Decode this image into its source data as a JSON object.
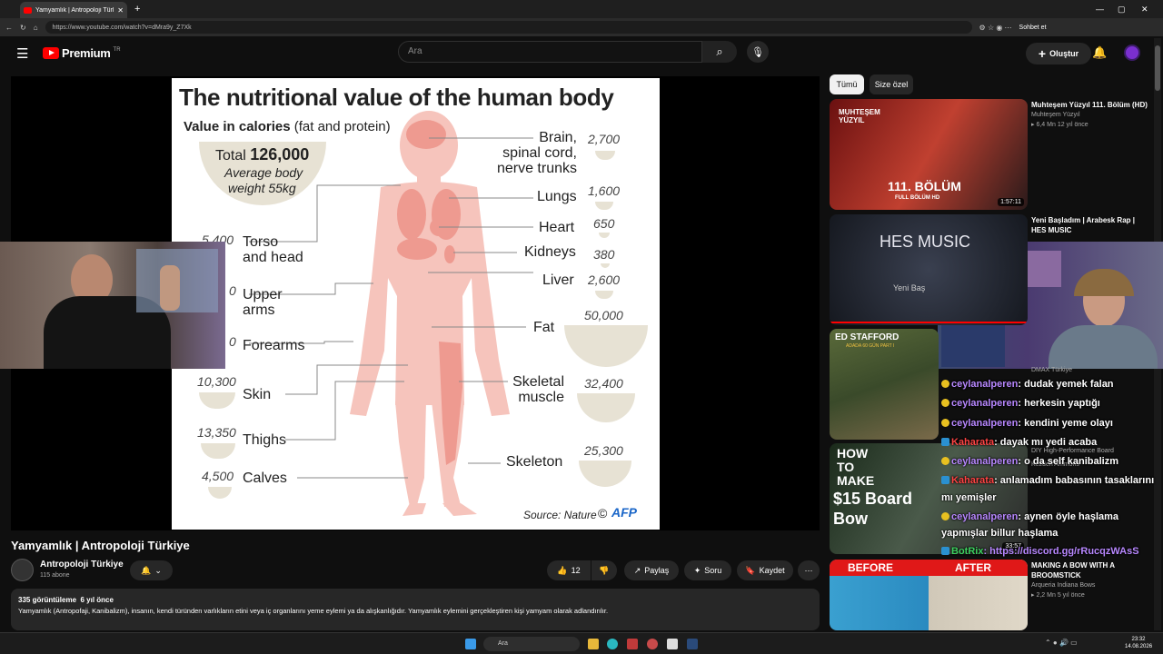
{
  "browser": {
    "tab_title": "Yamyamlık | Antropoloji Türkiye -",
    "url": "https://www.youtube.com/watch?v=dMra9y_Z7Xk",
    "chat_button": "Sohbet et"
  },
  "header": {
    "logo_text": "Premium",
    "logo_region": "TR",
    "search_placeholder": "Ara",
    "create_label": "Oluştur"
  },
  "chips": [
    "Tümü",
    "Size özel"
  ],
  "chart": {
    "title": "The nutritional value of the human body",
    "subtitle_bold": "Value in calories",
    "subtitle_rest": "(fat and protein)",
    "total_prefix": "Total",
    "total_value": "126,000",
    "avg1": "Average body",
    "avg2": "weight 55kg",
    "source": "Source: Nature",
    "agency": "AFP",
    "left": [
      {
        "label": "Torso",
        "label2": "and head",
        "value": "5,400"
      },
      {
        "label": "Upper",
        "label2": "arms",
        "value": "0"
      },
      {
        "label": "Forearms",
        "label2": "",
        "value": "0"
      },
      {
        "label": "Skin",
        "label2": "",
        "value": "10,300"
      },
      {
        "label": "Thighs",
        "label2": "",
        "value": "13,350"
      },
      {
        "label": "Calves",
        "label2": "",
        "value": "4,500"
      }
    ],
    "right": [
      {
        "label": "Brain,",
        "label2": "spinal cord,",
        "label3": "nerve trunks",
        "value": "2,700"
      },
      {
        "label": "Lungs",
        "value": "1,600"
      },
      {
        "label": "Heart",
        "value": "650"
      },
      {
        "label": "Kidneys",
        "value": "380"
      },
      {
        "label": "Liver",
        "value": "2,600"
      },
      {
        "label": "Fat",
        "value": "50,000"
      },
      {
        "label": "Skeletal",
        "label2": "muscle",
        "value": "32,400"
      },
      {
        "label": "Skeleton",
        "value": "25,300"
      }
    ]
  },
  "video": {
    "title": "Yamyamlık | Antropoloji Türkiye",
    "channel": "Antropoloji Türkiye",
    "subscribers": "115 abone",
    "likes": "12",
    "share": "Paylaş",
    "ask": "Soru",
    "save": "Kaydet",
    "views": "335 görüntüleme",
    "age": "6 yıl önce",
    "description": "Yamyamlık (Antropofaji, Kanibalizm), insanın, kendi türünden varlıkların  etini veya iç organlarını yeme eylemi ya da alışkanlığıdır. Yamyamlık eylemini gerçekleştiren kişi yamyam olarak adlandırılır."
  },
  "sidebar": [
    {
      "title": "Muhteşem Yüzyıl 111. Bölüm (HD)",
      "channel": "Muhteşem Yüzyıl",
      "stats": "6,4 Mn   12 yıl önce",
      "duration": "1:57:11",
      "thumb_text": "111. BÖLÜM",
      "thumb_sub": "FULL BÖLÜM HD",
      "thumb_brand": "MUHTEŞEM YÜZYIL"
    },
    {
      "title": "Yeni Başladım | Arabesk Rap | HES MUSIC",
      "channel": "",
      "stats": "",
      "duration": "",
      "thumb_text": "HES MUSIC",
      "thumb_sub": "Yeni Baş"
    },
    {
      "title": "",
      "channel": "DMAX Türkiye",
      "stats": "",
      "duration": "",
      "thumb_text": "ED STAFFORD",
      "thumb_sub": "ADADA 60 GÜN PART I"
    },
    {
      "title": "DIY High-Performance Board",
      "channel": "Kezden Ammons",
      "stats": "",
      "duration": "33:57",
      "thumb_text": "HOW TO MAKE",
      "thumb_sub": "$15 Board Bow"
    },
    {
      "title": "MAKING A BOW WITH A BROOMSTICK",
      "channel": "Arqueria Indiana Bows",
      "stats": "2,2 Mn   5 yıl önce",
      "duration": "",
      "thumb_text": "BEFORE",
      "thumb_sub": "AFTER"
    }
  ],
  "chat_messages": [
    {
      "user": "ceylanalperen",
      "text": ": dudak yemek falan",
      "style": "purple"
    },
    {
      "user": "ceylanalperen",
      "text": ": herkesin yaptığı",
      "style": "purple"
    },
    {
      "user": "ceylanalperen",
      "text": ": kendini yeme olayı",
      "style": "purple"
    },
    {
      "user": "Kaharata",
      "text": ": dayak mı yedi acaba",
      "style": "red"
    },
    {
      "user": "ceylanalperen",
      "text": ": o da self kanibalizm",
      "style": "purple"
    },
    {
      "user": "Kaharata",
      "text": ": anlamadım babasının tasaklarını",
      "style": "red"
    },
    {
      "user": "",
      "text": "mı yemişler",
      "style": "plain"
    },
    {
      "user": "ceylanalperen",
      "text": ": aynen öyle haşlama",
      "style": "purple"
    },
    {
      "user": "",
      "text": "yapmışlar billur haşlama",
      "style": "plain"
    },
    {
      "user": "BotRix",
      "text": ": https://discord.gg/rRucqzWAsS",
      "style": "bot"
    }
  ],
  "taskbar": {
    "search": "Ara",
    "time": "23:32",
    "date": "14.08.2026"
  },
  "colors": {
    "youtube_red": "#ff0000",
    "chat_purple": "#b888ff",
    "chat_red": "#ff4444",
    "body_pink": "#f6c4bc"
  }
}
